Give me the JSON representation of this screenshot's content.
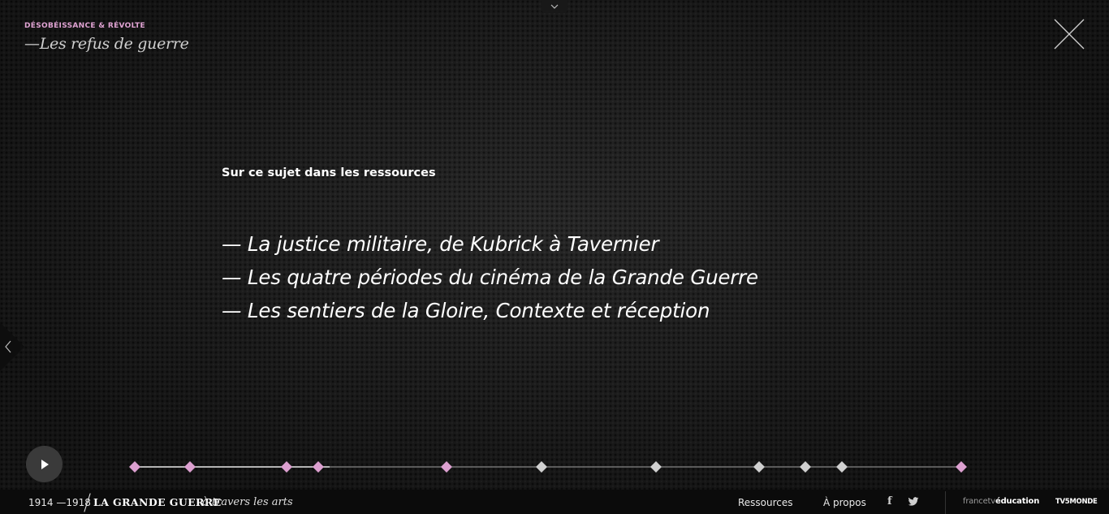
{
  "header": {
    "kicker": "DÉSOBÉISSANCE & RÉVOLTE",
    "title": "—Les refus de guerre"
  },
  "main": {
    "heading": "Sur ce sujet dans les ressources",
    "resources": [
      "— La justice militaire, de Kubrick à Tavernier",
      "— Les quatre périodes du cinéma de la Grande Guerre",
      "— Les sentiers de la Gloire, Contexte et réception"
    ]
  },
  "timeline": {
    "accent_color": "#dca0d0",
    "inactive_color": "#d0d0d0",
    "markers": [
      {
        "state": "visited"
      },
      {
        "state": "visited"
      },
      {
        "state": "visited"
      },
      {
        "state": "current"
      },
      {
        "state": "visited"
      },
      {
        "state": "upcoming"
      },
      {
        "state": "upcoming"
      },
      {
        "state": "upcoming"
      },
      {
        "state": "upcoming"
      },
      {
        "state": "upcoming"
      },
      {
        "state": "visited"
      }
    ]
  },
  "footer": {
    "years": "1914 —1918",
    "brand": "LA GRANDE GUERRE",
    "tagline": "à travers les arts",
    "nav": {
      "resources": "Ressources",
      "about": "À propos"
    },
    "social": {
      "facebook": "f",
      "twitter": "twitter-icon"
    },
    "partner1_prefix": "francetv",
    "partner1_suffix": "éducation",
    "partner2": "TV5MONDE"
  },
  "icons": [
    "chevron-down-icon",
    "close-icon",
    "chevron-left-icon",
    "play-icon",
    "facebook-icon",
    "twitter-icon"
  ]
}
